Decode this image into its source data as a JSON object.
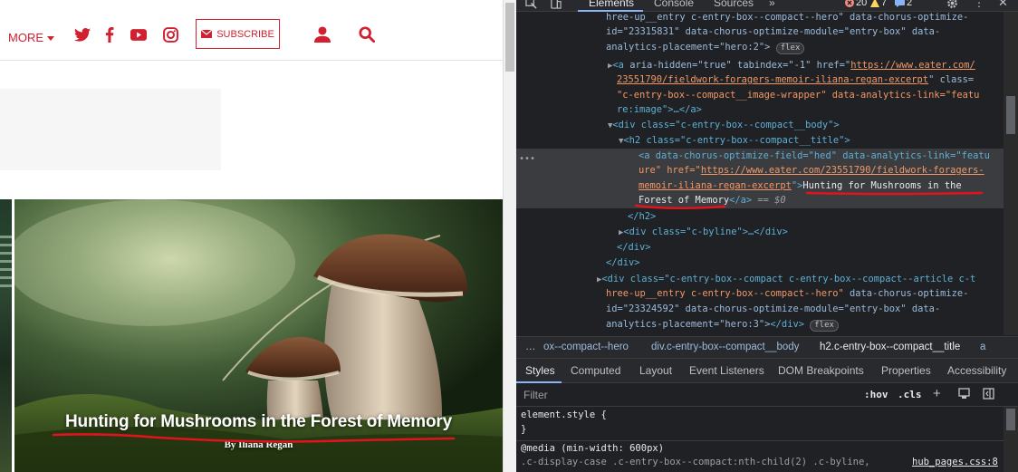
{
  "site": {
    "nav_more": "MORE",
    "subscribe_label": "SUBSCRIBE",
    "accent_color": "#d1202f",
    "hero": {
      "title": "Hunting for Mushrooms in the Forest of Memory",
      "byline": "By Iliana Regan"
    }
  },
  "devtools": {
    "tabs": [
      "Elements",
      "Console",
      "Sources"
    ],
    "more_tabs": "»",
    "active_tab": "Elements",
    "error_count": "20",
    "warning_count": "7",
    "message_count": "2",
    "dom_lines": {
      "l1_a": "hree-up__entry c-entry-box--compact--hero\" ",
      "l1_b": "data-chorus-optimize-",
      "l2_a": "id=\"23315831\" ",
      "l2_b": "data-chorus-optimize-module=\"entry-box\" ",
      "l2_c": "data-",
      "l3_a": "analytics-placement=\"hero:2\">",
      "l3_pill": "flex",
      "l4_tag": "<a ",
      "l4_attrs": "aria-hidden=\"true\" tabindex=\"-1\" href=\"",
      "l4_link": "https://www.eater.com/",
      "l5_link": "23551790/fieldwork-foragers-memoir-iliana-regan-excerpt",
      "l5_tail": "\" class=",
      "l6": "\"c-entry-box--compact__image-wrapper\" data-analytics-link=\"featu",
      "l7": "re:image\">…</a>",
      "l8": "<div class=\"c-entry-box--compact__body\">",
      "l9": "<h2 class=\"c-entry-box--compact__title\">",
      "l10": "<a data-chorus-optimize-field=\"hed\" data-analytics-link=\"featu",
      "l11_a": "ure\" href=\"",
      "l11_link": "https://www.eater.com/23551790/fieldwork-foragers-",
      "l12_link": "memoir-iliana-regan-excerpt",
      "l12_b": "\">",
      "l12_text": "Hunting for Mushrooms in the",
      "l13_text": "Forest of Memory",
      "l13_close": "</a>",
      "l13_eq": " == $0",
      "l14": "</h2>",
      "l15": "<div class=\"c-byline\">…</div>",
      "l16": "</div>",
      "l17": "</div>",
      "l18": "<div class=\"c-entry-box--compact c-entry-box--compact--article c-t",
      "l19_a": "hree-up__entry c-entry-box--compact--hero\" ",
      "l19_b": "data-chorus-optimize-",
      "l20_a": "id=\"23324592\" ",
      "l20_b": "data-chorus-optimize-module=\"entry-box\" ",
      "l20_c": "data-",
      "l21_a": "analytics-placement=\"hero:3\">",
      "l21_b": "</div>",
      "l21_pill": "flex",
      "ellipsis": "…"
    },
    "breadcrumbs": [
      "…",
      "ox--compact--hero",
      "div.c-entry-box--compact__body",
      "h2.c-entry-box--compact__title",
      "a"
    ],
    "style_tabs": [
      "Styles",
      "Computed",
      "Layout",
      "Event Listeners",
      "DOM Breakpoints",
      "Properties",
      "Accessibility"
    ],
    "filter_placeholder": "Filter",
    "hov_label": ":hov",
    "cls_label": ".cls",
    "styles": {
      "element_style": "element.style {",
      "close_brace": "}",
      "media": "@media (min-width: 600px)",
      "selector": ".c-display-case .c-entry-box--compact:nth-child(2) .c-byline,",
      "source": "hub_pages.css:8"
    }
  },
  "annotation_color": "#e0141e"
}
